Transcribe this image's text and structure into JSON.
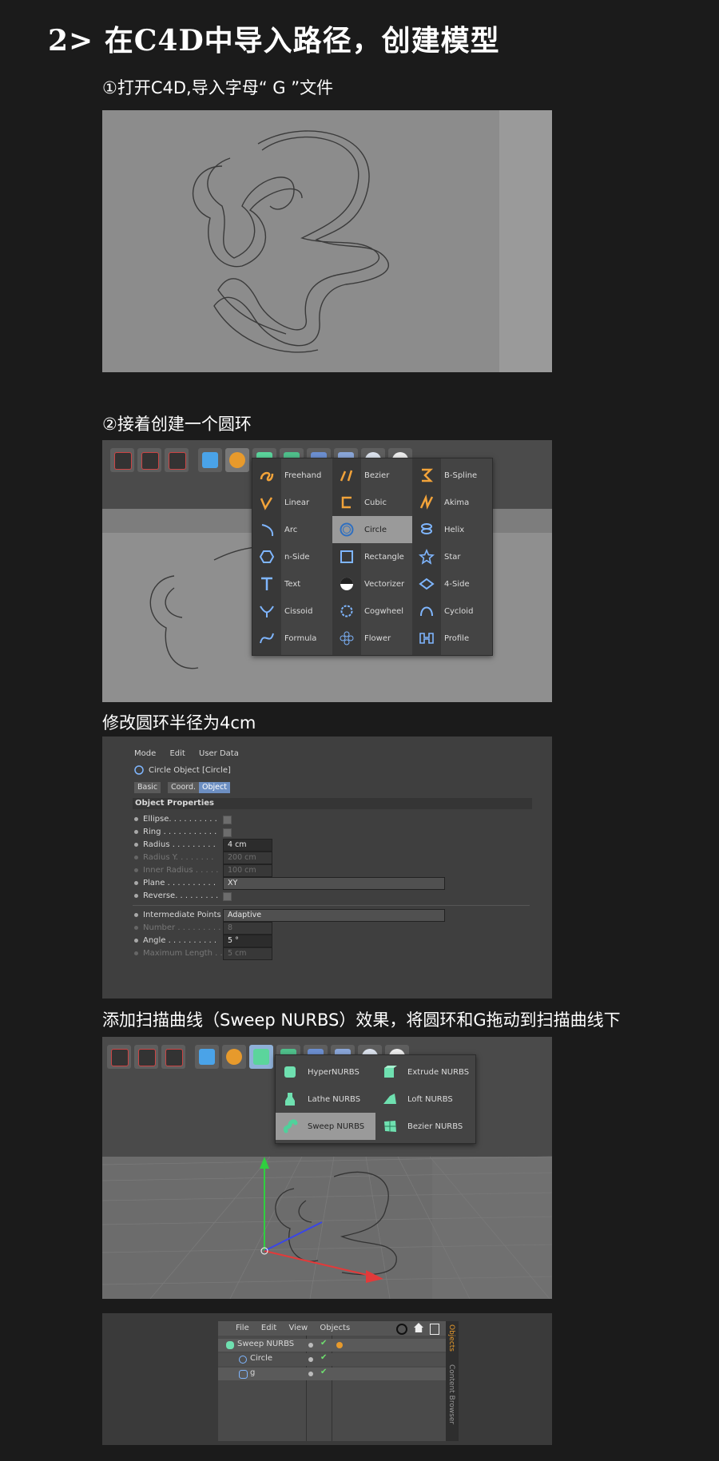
{
  "heading": "2>  在C4D中导入路径，创建模型",
  "steps": {
    "s1": "①打开C4D,导入字母“ G ”文件",
    "s2": "②接着创建一个圆环",
    "s3": "修改圆环半径为4cm",
    "s4": "添加扫描曲线（Sweep NURBS）效果，将圆环和G拖动到扫描曲线下"
  },
  "spline_menu": {
    "col1": [
      "Freehand",
      "Linear",
      "Arc",
      "n-Side",
      "Text",
      "Cissoid",
      "Formula"
    ],
    "col2": [
      "Bezier",
      "Cubic",
      "Circle",
      "Rectangle",
      "Vectorizer",
      "Cogwheel",
      "Flower"
    ],
    "col3": [
      "B-Spline",
      "Akima",
      "Helix",
      "Star",
      "4-Side",
      "Cycloid",
      "Profile"
    ],
    "selected": "Circle"
  },
  "attributes": {
    "menu": [
      "Mode",
      "Edit",
      "User Data"
    ],
    "object_title": "Circle Object [Circle]",
    "tabs": [
      "Basic",
      "Coord.",
      "Object"
    ],
    "section": "Object Properties",
    "rows": {
      "ellipse": "Ellipse. . . . . . . . . .",
      "ring": "Ring . . . . . . . . . . .",
      "radius": "Radius . . . . . . . . .",
      "radius_y": "Radius Y. . . . . . . .",
      "inner_radius": "Inner Radius . . . . .",
      "plane": "Plane . . . . . . . . . .",
      "reverse": "Reverse. . . . . . . . .",
      "intermediate": "Intermediate Points",
      "number": "Number . . . . . . . . .",
      "angle": "Angle . . . . . . . . . .",
      "max_length": "Maximum Length . ."
    },
    "values": {
      "radius": "4 cm",
      "radius_y": "200 cm",
      "inner_radius": "100 cm",
      "plane": "XY",
      "intermediate": "Adaptive",
      "number": "8",
      "angle": "5 °",
      "max_length": "5 cm"
    }
  },
  "nurbs_menu": {
    "col1": [
      "HyperNURBS",
      "Lathe NURBS",
      "Sweep NURBS"
    ],
    "col2": [
      "Extrude NURBS",
      "Loft NURBS",
      "Bezier NURBS"
    ],
    "selected": "Sweep NURBS"
  },
  "objects_panel": {
    "menu": [
      "File",
      "Edit",
      "View",
      "Objects"
    ],
    "items": [
      "Sweep NURBS",
      "Circle",
      "g"
    ],
    "side_tabs": [
      "Objects",
      "Content Browser"
    ]
  },
  "colors": {
    "menu_bg": "#444444",
    "selection": "#9a9a9a",
    "spline_orange": "#f2a33a",
    "spline_blue": "#7fb6ff",
    "nurbs_green": "#6fe0b0"
  }
}
